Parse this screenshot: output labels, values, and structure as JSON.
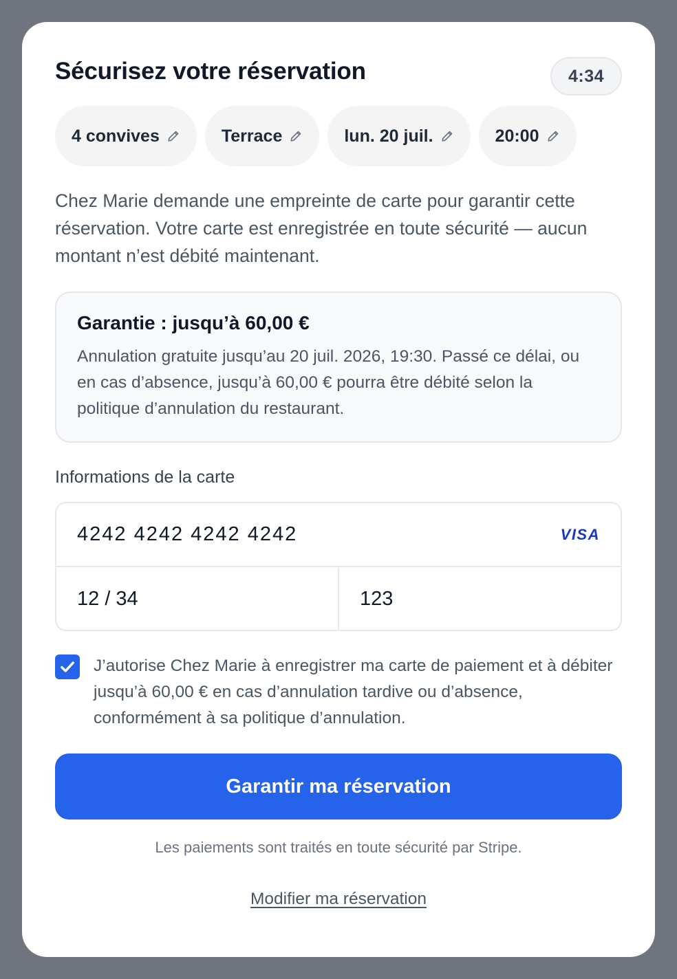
{
  "header": {
    "title": "Sécurisez votre réservation",
    "timer": "4:34"
  },
  "chips": [
    {
      "label": "4 convives",
      "icon": "pencil-icon"
    },
    {
      "label": "Terrace",
      "icon": "pencil-icon"
    },
    {
      "label": "lun. 20 juil.",
      "icon": "pencil-icon"
    },
    {
      "label": "20:00",
      "icon": "pencil-icon"
    }
  ],
  "intro": "Chez Marie demande une empreinte de carte pour garantir cette réservation. Votre carte est enregistrée en toute sécurité — aucun montant n’est débité maintenant.",
  "guarantee": {
    "title": "Garantie : jusqu’à 60,00 €",
    "text": "Annulation gratuite jusqu’au 20 juil. 2026, 19:30. Passé ce délai, ou en cas d’absence, jusqu’à 60,00 € pourra être débité selon la politique d’annulation du restaurant."
  },
  "card_form": {
    "label": "Informations de la carte",
    "number": "4242 4242 4242 4242",
    "brand": "VISA",
    "expiry": "12 / 34",
    "cvc": "123"
  },
  "consent": {
    "checked": true,
    "text": "J’autorise Chez Marie à enregistrer ma carte de paiement et à débiter jusqu’à 60,00 € en cas d’annulation tardive ou d’absence, conformément à sa politique d’annulation."
  },
  "submit_label": "Garantir ma réservation",
  "stripe_note": "Les paiements sont traités en toute sécurité par Stripe.",
  "modify_link": "Modifier ma réservation",
  "colors": {
    "accent": "#2563eb",
    "visa": "#1a39b8",
    "backdrop": "#6e737d"
  }
}
